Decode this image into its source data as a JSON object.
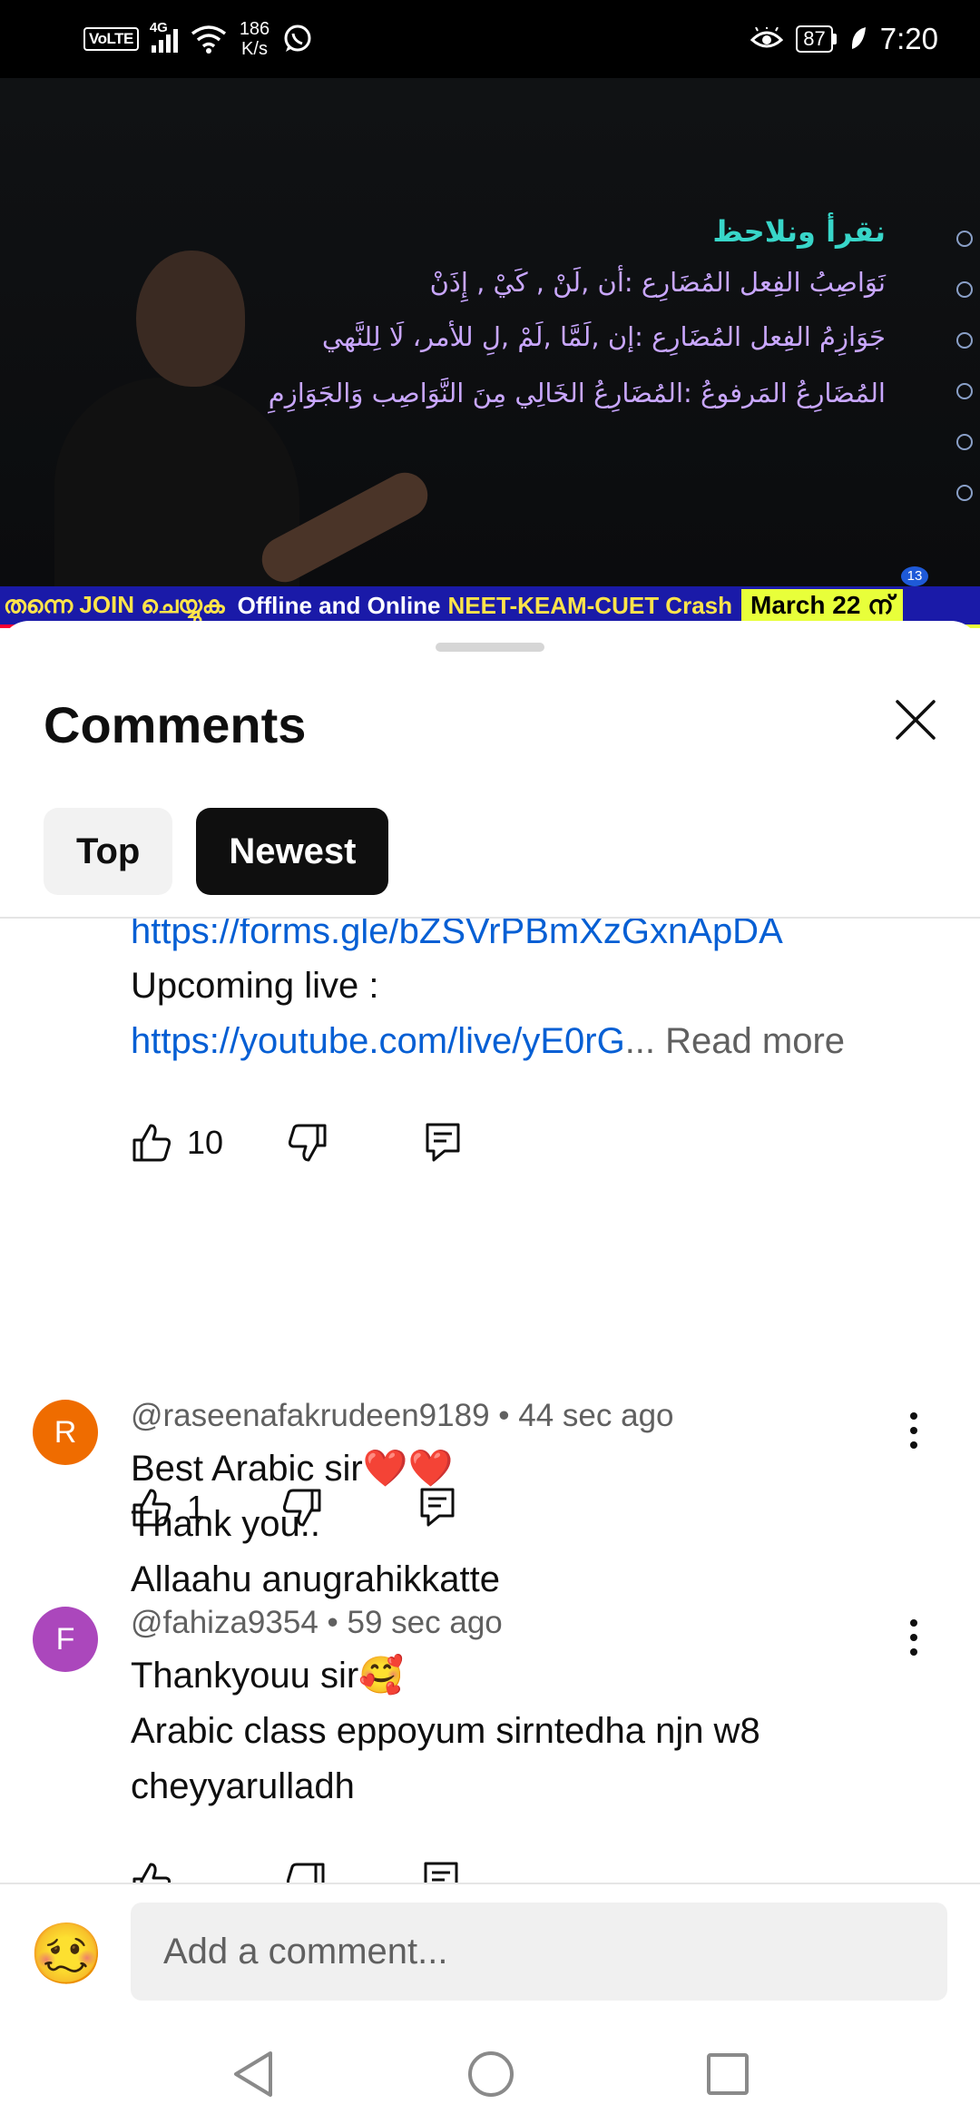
{
  "status_bar": {
    "volte": "VoLTE",
    "network": "4G",
    "speed_value": "186",
    "speed_unit": "K/s",
    "battery": "87",
    "time": "7:20"
  },
  "video": {
    "board_title": "نقرأ ونلاحظ",
    "board_lines": [
      "نَوَاصِبُ الفِعل المُضَارِع :أن ,لَنْ , كَيْ , إِذَنْ",
      "جَوَازِمُ الفِعل المُضَارِع :إن ,لَمَّا ,لَمْ ,لِ للأمر، لَا لِلنَّهي",
      "المُضَارِعُ المَرفوعُ :المُضَارِعُ الخَالِي مِنَ النَّوَاصِب وَالجَوَازِمِ"
    ],
    "ticker": {
      "part1": "തന്നെ JOIN ചെയ്യുക",
      "part2": "Offline and Online",
      "part3": "NEET-KEAM-CUET Crash",
      "part4": "March 22 ന്"
    },
    "badge": "13"
  },
  "sheet": {
    "title": "Comments",
    "tabs": [
      "Top",
      "Newest"
    ],
    "selected_tab": "Newest"
  },
  "comments": [
    {
      "lines": {
        "link1": "https://forms.gle/bZSVrPBmXzGxnApDA",
        "label": "Upcoming live :",
        "link2": "https://youtube.com/live/yE0rG",
        "ellipsis": "...",
        "read_more": "Read more"
      },
      "likes": "10"
    },
    {
      "avatar_letter": "R",
      "avatar_color": "#ef6c00",
      "author": "@raseenafakrudeen9189",
      "separator": "•",
      "time": "44 sec ago",
      "line1": "Best Arabic sir❤️❤️",
      "line2": "Thank you..",
      "line3": "Allaahu anugrahikkatte",
      "likes": "1"
    },
    {
      "avatar_letter": "F",
      "avatar_color": "#ab47bc",
      "author": "@fahiza9354",
      "separator": "•",
      "time": "59 sec ago",
      "line1": "Thankyouu sir🥰",
      "line2": "Arabic class eppoyum sirntedha njn w8",
      "line3": "cheyyarulladh"
    }
  ],
  "composer": {
    "emoji": "🥴",
    "placeholder": "Add a comment..."
  },
  "icons": {
    "like": "thumb-up-icon",
    "dislike": "thumb-down-icon",
    "reply": "reply-icon",
    "close": "close-icon",
    "more": "more-vert-icon"
  },
  "colors": {
    "link": "#065fd4",
    "chip_selected_bg": "#0f0f0f",
    "chip_bg": "#f2f2f2",
    "progress": "#ff0033"
  }
}
